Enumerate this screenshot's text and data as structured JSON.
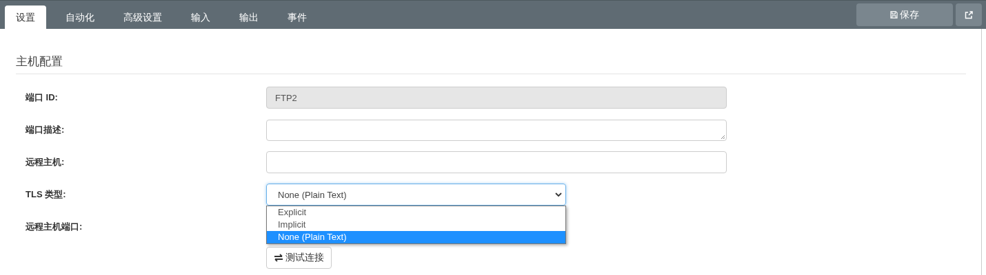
{
  "tabs": [
    {
      "label": "设置",
      "selected": true
    },
    {
      "label": "自动化",
      "selected": false
    },
    {
      "label": "高级设置",
      "selected": false
    },
    {
      "label": "输入",
      "selected": false
    },
    {
      "label": "输出",
      "selected": false
    },
    {
      "label": "事件",
      "selected": false
    }
  ],
  "toolbar": {
    "save_label": "保存"
  },
  "section": {
    "title": "主机配置"
  },
  "fields": [
    {
      "kind": "input",
      "label": "端口 ID:",
      "value": "FTP2",
      "disabled": true
    },
    {
      "kind": "textarea",
      "label": "端口描述:",
      "disabled": false
    },
    {
      "kind": "input",
      "label": "远程主机:",
      "disabled": false
    },
    {
      "kind": "select",
      "label": "TLS 类型:",
      "value": "None (Plain Text)",
      "expanded": true,
      "options": [
        {
          "label": "Explicit",
          "selected": false
        },
        {
          "label": "Implicit",
          "selected": false
        },
        {
          "label": "None (Plain Text)",
          "selected": true
        }
      ]
    },
    {
      "kind": "hidden",
      "label": "远程主机端口:"
    }
  ],
  "test_button": {
    "label": "测试连接"
  }
}
